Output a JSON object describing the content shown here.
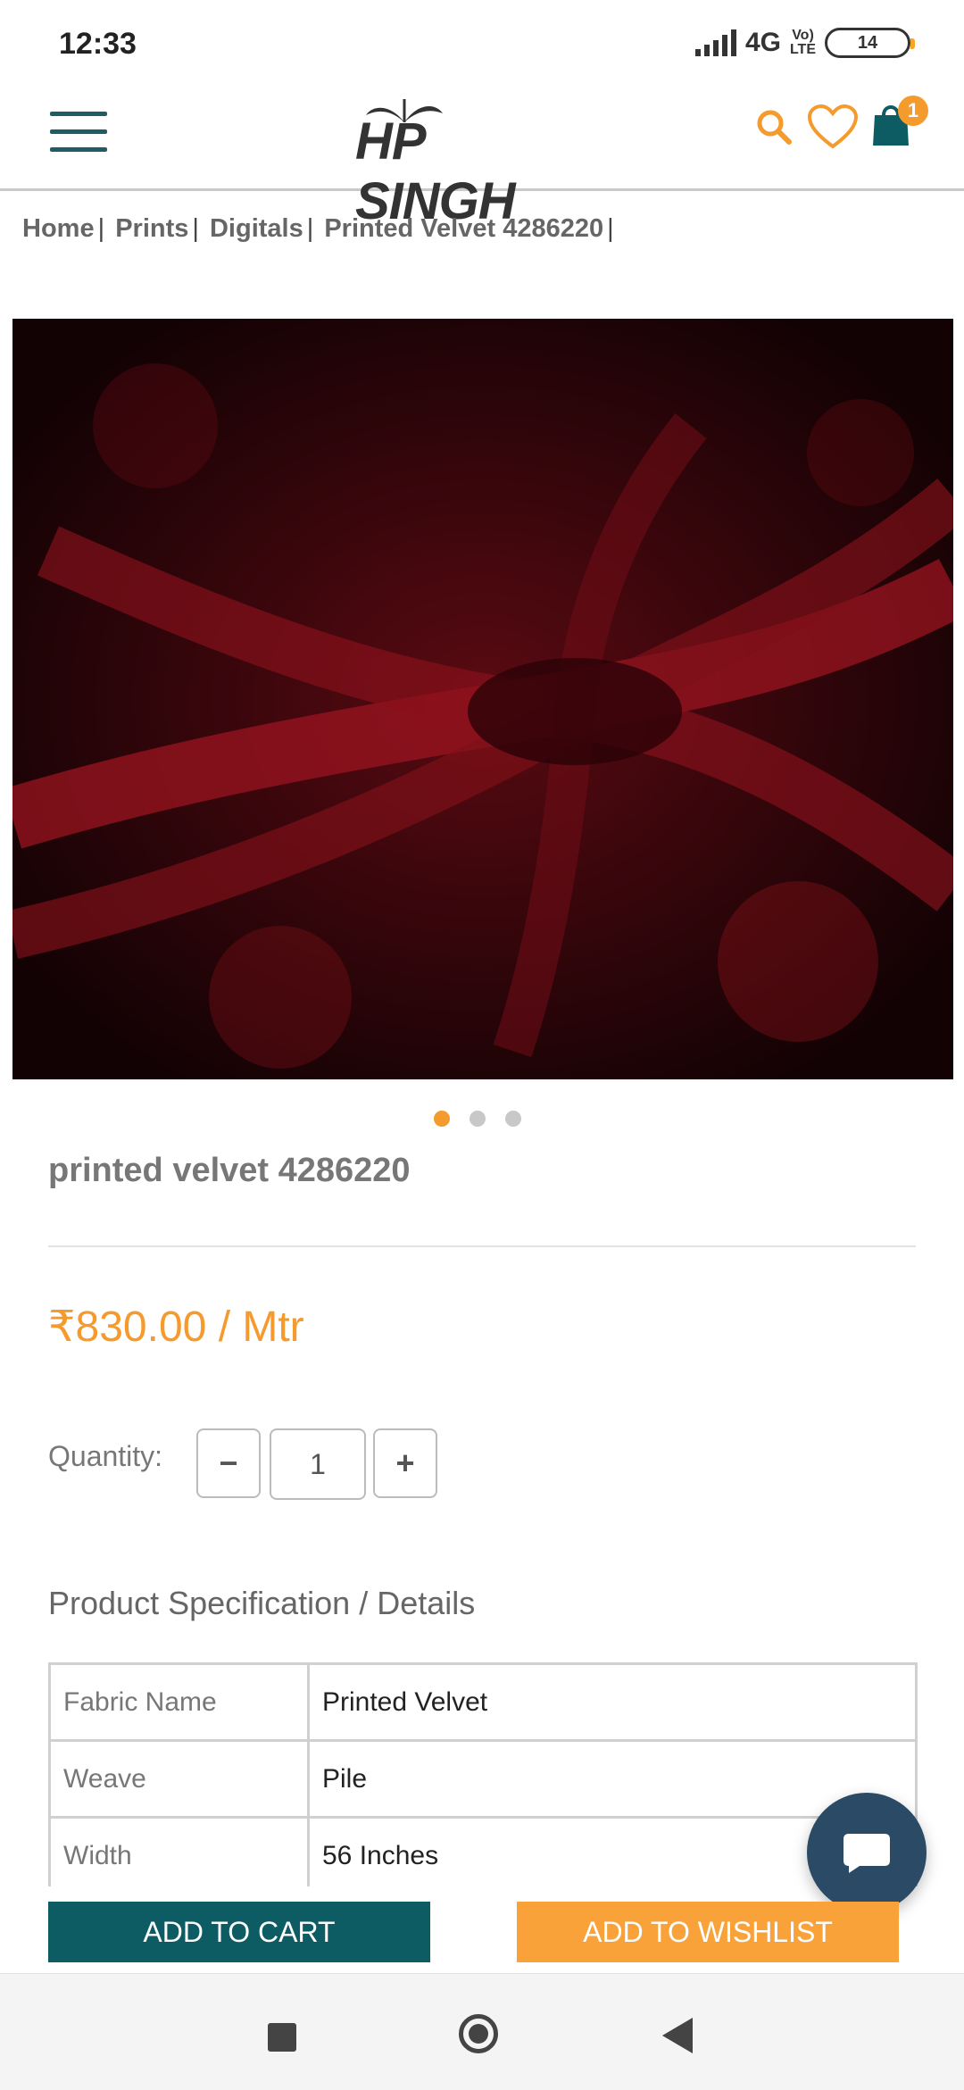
{
  "status_bar": {
    "time": "12:33",
    "network": "4G",
    "volte_top": "Vo)",
    "volte_bottom": "LTE",
    "battery": "14"
  },
  "header": {
    "logo_text": "HP SINGH",
    "cart_count": "1",
    "accent_color": "#f59a2d",
    "brand_color": "#0d5c63"
  },
  "breadcrumb": {
    "items": [
      "Home",
      "Prints",
      "Digitals",
      "Printed Velvet 4286220"
    ]
  },
  "carousel": {
    "image_label": "printed red velvet fabric",
    "dots_total": 3,
    "active_dot": 1
  },
  "product": {
    "title": "printed velvet 4286220",
    "price": "₹830.00 / Mtr"
  },
  "quantity": {
    "label": "Quantity:",
    "value": "1",
    "minus": "−",
    "plus": "+"
  },
  "specs": {
    "heading": "Product Specification / Details",
    "rows": [
      {
        "key": "Fabric Name",
        "value": "Printed Velvet"
      },
      {
        "key": "Weave",
        "value": "Pile"
      },
      {
        "key": "Width",
        "value": "56 Inches"
      }
    ]
  },
  "actions": {
    "add_to_cart": "ADD TO CART",
    "add_to_wishlist": "ADD TO WISHLIST"
  }
}
